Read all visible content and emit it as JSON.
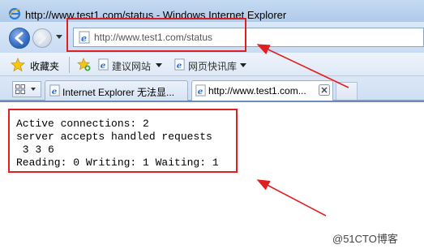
{
  "window": {
    "title": "http://www.test1.com/status - Windows Internet Explorer"
  },
  "navigation": {
    "back_icon": "back-arrow-icon",
    "forward_icon": "forward-arrow-icon",
    "address_url": "http://www.test1.com/status",
    "page_icon": "ie-page-icon"
  },
  "favorites_bar": {
    "favorites_label": "收藏夹",
    "items": [
      {
        "label": "建议网站",
        "icon": "ie-page-icon"
      },
      {
        "label": "网页快讯库",
        "icon": "ie-page-icon"
      }
    ]
  },
  "tabs": [
    {
      "label": "Internet Explorer 无法显...",
      "active": false
    },
    {
      "label": "http://www.test1.com...",
      "active": true
    }
  ],
  "page": {
    "lines": [
      "Active connections: 2",
      "server accepts handled requests",
      " 3 3 6",
      "Reading: 0 Writing: 1 Waiting: 1"
    ]
  },
  "annotations": {
    "highlight_color": "#e02020"
  },
  "watermark": "@51CTO博客"
}
